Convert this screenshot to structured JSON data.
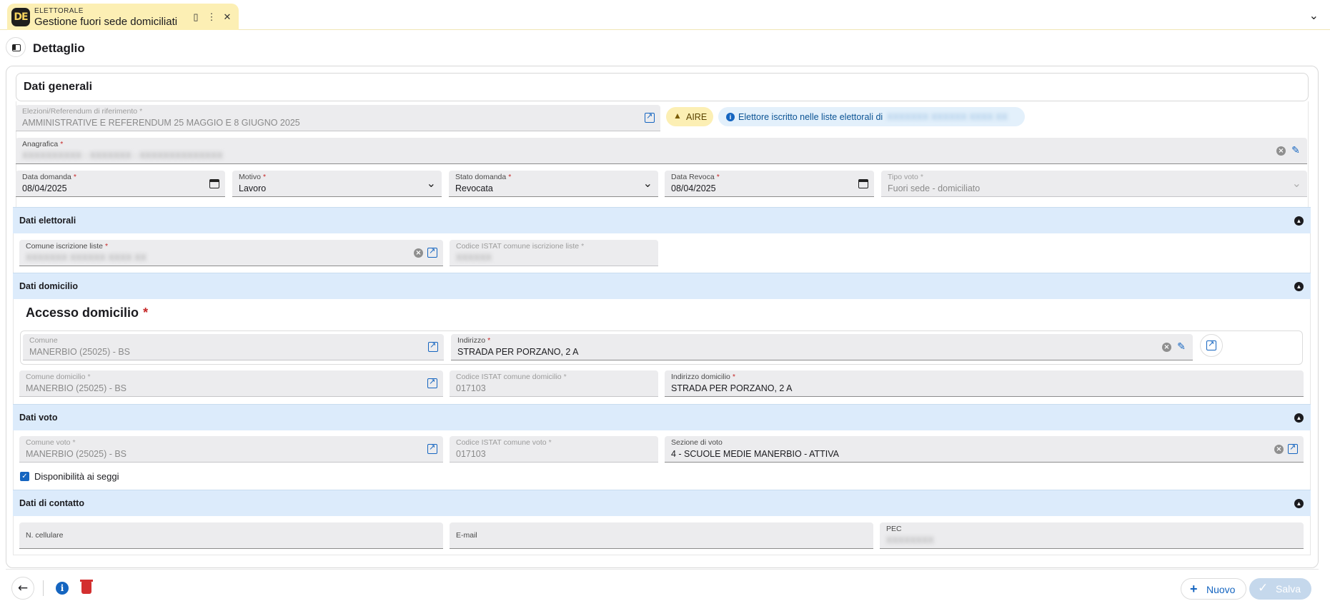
{
  "tab": {
    "logo": "DE",
    "module": "ELETTORALE",
    "title": "Gestione fuori sede domiciliati"
  },
  "page": {
    "title": "Dettaglio"
  },
  "dati_generali": {
    "title": "Dati generali",
    "elezioni": {
      "label": "Elezioni/Referendum di riferimento",
      "value": "AMMINISTRATIVE E REFERENDUM 25 MAGGIO E 8 GIUGNO 2025"
    },
    "aire_badge": "AIRE",
    "info_badge": {
      "text": "Elettore iscritto nelle liste elettorali di",
      "value": "XXXXXXX XXXXXX XXXX XX"
    },
    "anagrafica": {
      "label": "Anagrafica",
      "value": "XXXXXXXXXX - XXXXXXX - XXXXXXXXXXXXXX"
    },
    "data_domanda": {
      "label": "Data domanda",
      "value": "08/04/2025"
    },
    "motivo": {
      "label": "Motivo",
      "value": "Lavoro"
    },
    "stato_domanda": {
      "label": "Stato domanda",
      "value": "Revocata"
    },
    "data_revoca": {
      "label": "Data Revoca",
      "value": "08/04/2025"
    },
    "tipo_voto": {
      "label": "Tipo voto",
      "value": "Fuori sede - domiciliato"
    }
  },
  "dati_elettorali": {
    "title": "Dati elettorali",
    "comune_iscrizione": {
      "label": "Comune iscrizione liste",
      "value": "XXXXXXX XXXXXX XXXX XX"
    },
    "codice_istat": {
      "label": "Codice ISTAT comune iscrizione liste",
      "value": "XXXXXX"
    }
  },
  "dati_domicilio": {
    "title": "Dati domicilio",
    "accesso_title": "Accesso domicilio",
    "comune": {
      "label": "Comune",
      "value": "MANERBIO (25025) - BS"
    },
    "indirizzo": {
      "label": "Indirizzo",
      "value": "STRADA PER PORZANO, 2 A"
    },
    "comune_domicilio": {
      "label": "Comune domicilio",
      "value": "MANERBIO (25025) - BS"
    },
    "codice_istat_domicilio": {
      "label": "Codice ISTAT comune domicilio",
      "value": "017103"
    },
    "indirizzo_domicilio": {
      "label": "Indirizzo domicilio",
      "value": "STRADA PER PORZANO, 2 A"
    }
  },
  "dati_voto": {
    "title": "Dati voto",
    "comune_voto": {
      "label": "Comune voto",
      "value": "MANERBIO (25025) - BS"
    },
    "codice_istat_voto": {
      "label": "Codice ISTAT comune voto",
      "value": "017103"
    },
    "sezione": {
      "label": "Sezione di voto",
      "value": "4 - SCUOLE MEDIE MANERBIO - ATTIVA"
    },
    "disponibilita": {
      "label": "Disponibilità ai seggi",
      "checked": true
    }
  },
  "dati_contatto": {
    "title": "Dati di contatto",
    "cellulare": {
      "label": "N. cellulare",
      "value": ""
    },
    "email": {
      "label": "E-mail",
      "value": ""
    },
    "pec": {
      "label": "PEC",
      "value": "XXXXXXXX"
    }
  },
  "footer": {
    "nuovo_label": "Nuovo",
    "salva_label": "Salva"
  },
  "colors": {
    "accent": "#1565c0",
    "tab_bg": "#fcefb4",
    "section_bg": "#dcebfb",
    "required": "#c62828",
    "danger": "#d32f2f"
  }
}
